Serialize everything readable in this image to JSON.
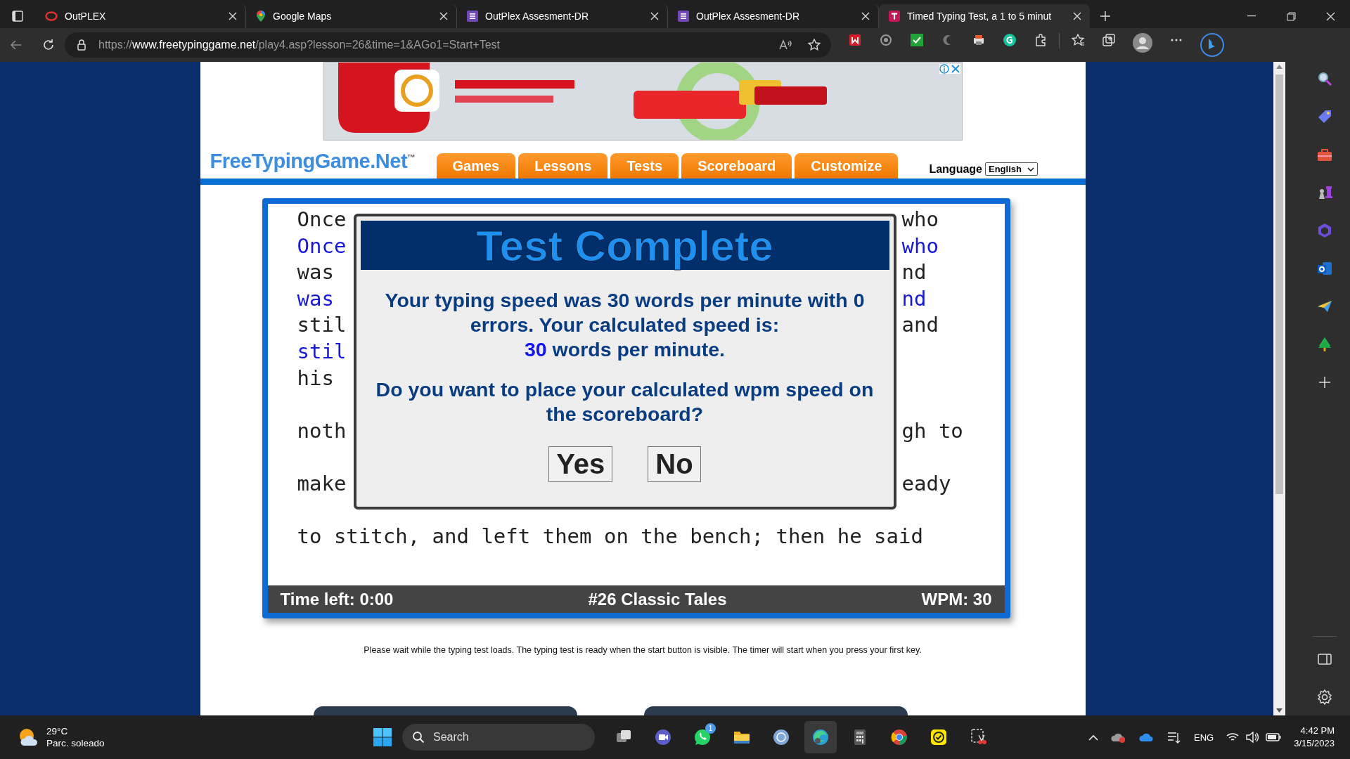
{
  "browser": {
    "tabs": [
      {
        "title": "OutPLEX",
        "kind": "ring",
        "selected": false
      },
      {
        "title": "Google Maps",
        "kind": "pin",
        "selected": false
      },
      {
        "title": "OutPlex Assesment-DR",
        "kind": "form",
        "selected": false
      },
      {
        "title": "OutPlex Assesment-DR",
        "kind": "form",
        "selected": false
      },
      {
        "title": "Timed Typing Test, a 1 to 5 minut",
        "kind": "site",
        "selected": true
      }
    ]
  },
  "address_bar": {
    "url_scheme": "https://",
    "url_domain": "www.freetypinggame.net",
    "url_path": "/play4.asp?lesson=26&time=1&AGo1=Start+Test"
  },
  "site": {
    "logo": "FreeTypingGame.Net$^{™}$",
    "nav": [
      {
        "label": "Games"
      },
      {
        "label": "Lessons"
      },
      {
        "label": "Tests"
      },
      {
        "label": "Scoreboard"
      },
      {
        "label": "Customize"
      }
    ],
    "language_label": "Language",
    "language_value": "English"
  },
  "typing_test": {
    "lines": [
      {
        "kind": "text",
        "left": "Once",
        "right": "who",
        "typed": false
      },
      {
        "kind": "text",
        "left": "Once",
        "right": "who",
        "typed": true
      },
      {
        "kind": "text",
        "left": "was",
        "right": "nd",
        "typed": false
      },
      {
        "kind": "text",
        "left": "was",
        "right": "nd",
        "typed": true
      },
      {
        "kind": "text",
        "left": "stil",
        "right": "and",
        "typed": false
      },
      {
        "kind": "text",
        "left": "stil",
        "typed": true
      },
      {
        "kind": "text",
        "left": "his",
        "typed": false
      },
      {
        "kind": "blank"
      },
      {
        "kind": "text",
        "left": "noth",
        "right": "gh to",
        "typed": false
      },
      {
        "kind": "blank"
      },
      {
        "kind": "text",
        "left": "make",
        "right": "eady",
        "typed": false
      },
      {
        "kind": "blank"
      },
      {
        "kind": "text",
        "left": "to stitch, and left them on the bench; then he said",
        "typed": false
      }
    ],
    "status": {
      "time_left": "Time left: 0:00",
      "lesson": "#26 Classic Tales",
      "wpm": "WPM: 30"
    }
  },
  "dialog": {
    "title": "Test Complete",
    "result_text": "Your typing speed was 30 words per minute with 0 errors. Your calculated speed is:",
    "calculated_value": "30",
    "calculated_unit": "words per minute.",
    "question": "Do you want to place your calculated wpm speed on the scoreboard?",
    "buttons": [
      "Yes",
      "No"
    ]
  },
  "footer_note": "Please wait while the typing test loads. The typing test is ready when the start button is visible. The timer will start when you press your first key.",
  "taskbar": {
    "weather_temp": "29°C",
    "weather_desc": "Parc. soleado",
    "search_placeholder": "Search",
    "apps": [
      {
        "kind": "taskview",
        "selected": false
      },
      {
        "kind": "meet",
        "selected": false
      },
      {
        "kind": "chat",
        "selected": false,
        "badge": "1"
      },
      {
        "kind": "folder",
        "selected": false
      },
      {
        "kind": "circle",
        "selected": false
      },
      {
        "kind": "browser",
        "selected": true
      },
      {
        "kind": "calculator",
        "selected": false
      },
      {
        "kind": "globe",
        "selected": false
      },
      {
        "kind": "check",
        "selected": false
      },
      {
        "kind": "snip",
        "selected": false
      }
    ],
    "language": "ENG",
    "time": "4:42 PM",
    "date": "3/15/2023"
  }
}
